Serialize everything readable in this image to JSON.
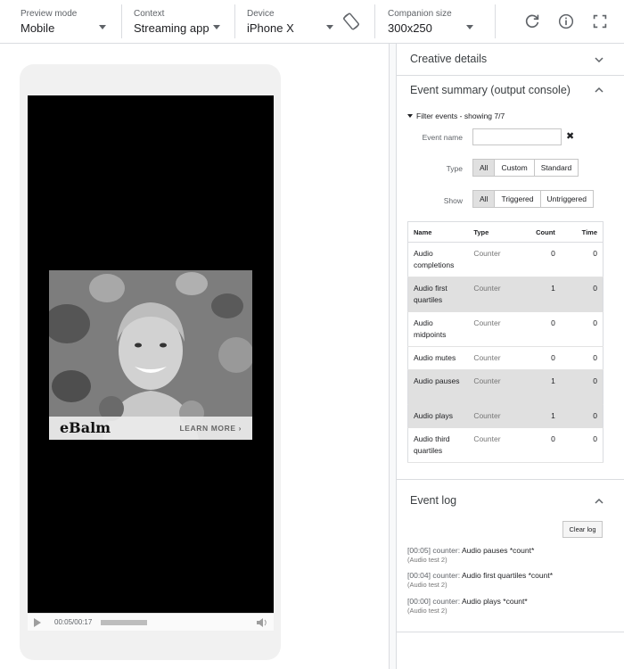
{
  "toolbar": {
    "preview_mode": {
      "label": "Preview mode",
      "value": "Mobile"
    },
    "context": {
      "label": "Context",
      "value": "Streaming app"
    },
    "device": {
      "label": "Device",
      "value": "iPhone X"
    },
    "companion_size": {
      "label": "Companion size",
      "value": "300x250"
    }
  },
  "preview": {
    "ad": {
      "brand": "eBalm",
      "cta": "LEARN MORE ›"
    },
    "player": {
      "time": "00:05/00:17",
      "progress": 0.29
    }
  },
  "panel": {
    "creative_details": {
      "title": "Creative details"
    },
    "event_summary": {
      "title": "Event summary (output console)",
      "filter_title": "Filter events - showing 7/7",
      "event_name_label": "Event name",
      "event_name_value": "",
      "clear_symbol": "✖",
      "type_label": "Type",
      "type_options": [
        "All",
        "Custom",
        "Standard"
      ],
      "show_label": "Show",
      "show_options": [
        "All",
        "Triggered",
        "Untriggered"
      ],
      "columns": {
        "name": "Name",
        "type": "Type",
        "count": "Count",
        "time": "Time"
      },
      "rows": [
        {
          "name": "Audio completions",
          "type": "Counter",
          "count": "0",
          "time": "0"
        },
        {
          "name": "Audio first quartiles",
          "type": "Counter",
          "count": "1",
          "time": "0"
        },
        {
          "name": "Audio midpoints",
          "type": "Counter",
          "count": "0",
          "time": "0"
        },
        {
          "name": "Audio mutes",
          "type": "Counter",
          "count": "0",
          "time": "0"
        },
        {
          "name": "Audio pauses",
          "type": "Counter",
          "count": "1",
          "time": "0"
        },
        {
          "name": "Audio plays",
          "type": "Counter",
          "count": "1",
          "time": "0"
        },
        {
          "name": "Audio third quartiles",
          "type": "Counter",
          "count": "0",
          "time": "0"
        }
      ]
    },
    "event_log": {
      "title": "Event log",
      "clear_label": "Clear log",
      "entries": [
        {
          "meta": "[00:05] counter: ",
          "event": "Audio pauses *count*",
          "sub": "(Audio test 2)"
        },
        {
          "meta": "[00:04] counter: ",
          "event": "Audio first quartiles *count*",
          "sub": "(Audio test 2)"
        },
        {
          "meta": "[00:00] counter: ",
          "event": "Audio plays *count*",
          "sub": "(Audio test 2)"
        }
      ]
    }
  }
}
